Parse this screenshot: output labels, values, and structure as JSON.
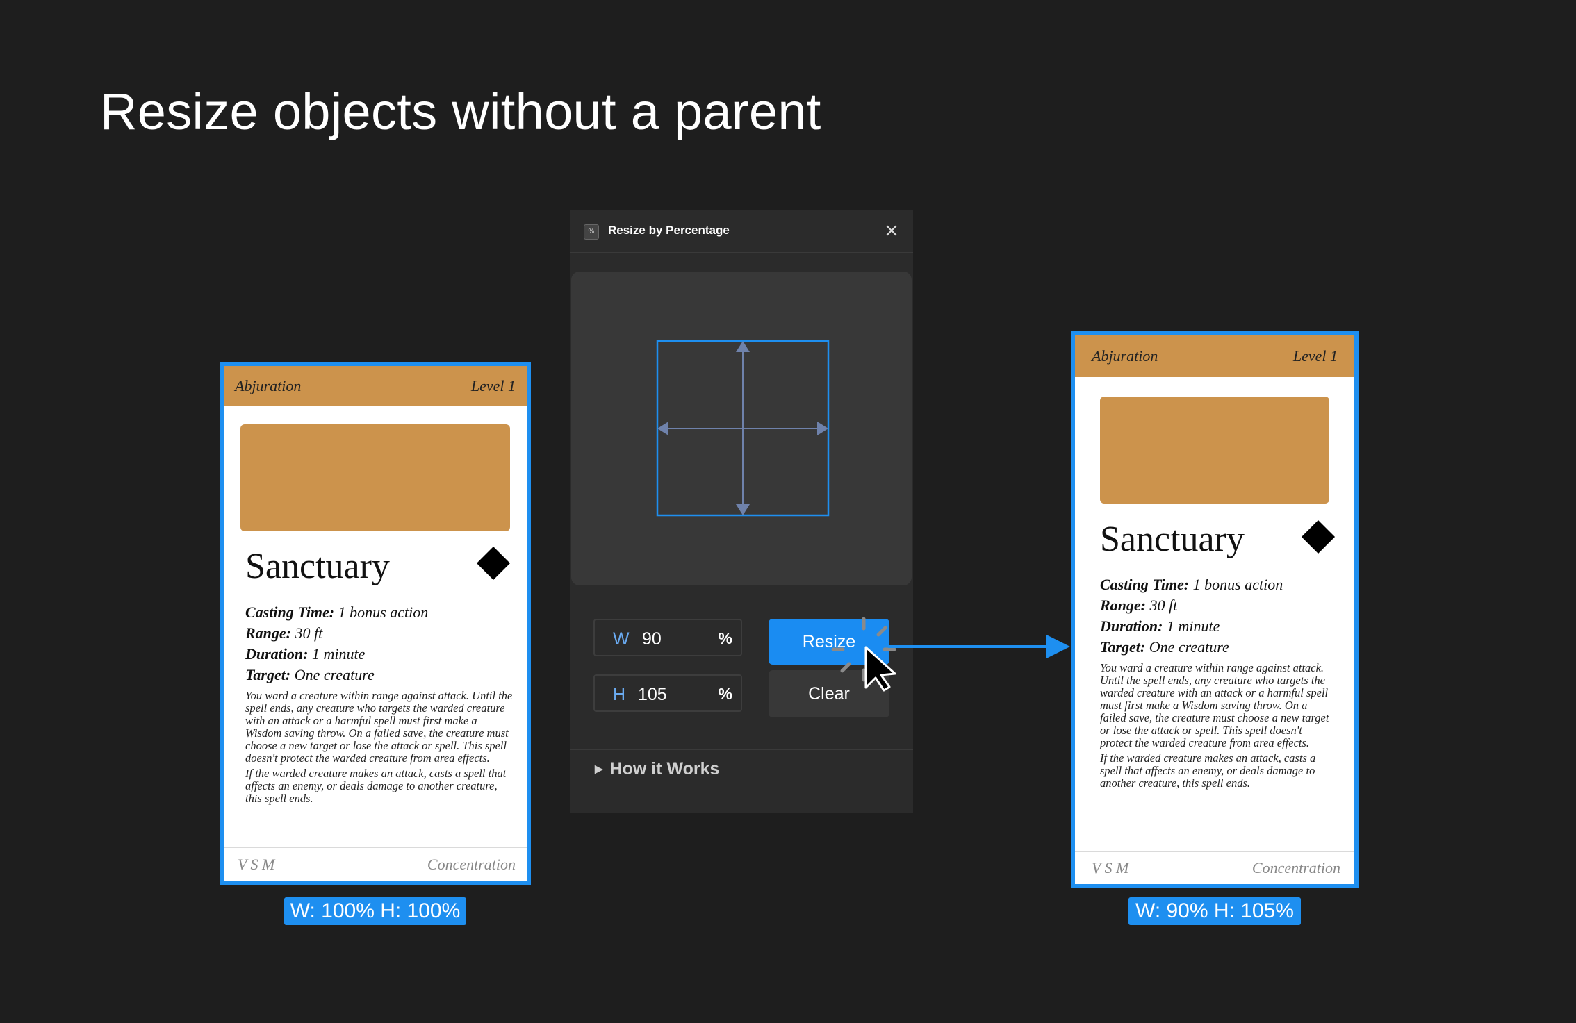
{
  "heading": "Resize objects without a parent",
  "card": {
    "school": "Abjuration",
    "level": "Level 1",
    "name": "Sanctuary",
    "stats": [
      {
        "label": "Casting Time:",
        "value": "1 bonus action"
      },
      {
        "label": "Range:",
        "value": "30 ft"
      },
      {
        "label": "Duration:",
        "value": "1 minute"
      },
      {
        "label": "Target:",
        "value": "One creature"
      }
    ],
    "description": [
      "You ward a creature within range against attack. Until the spell ends, any creature who targets the warded creature with an attack or a harmful spell must first make a Wisdom saving throw. On a failed save, the creature must choose a new target or lose the attack or spell. This spell doesn't protect the warded creature from area effects.",
      "If the warded creature makes an attack, casts a spell that affects an enemy, or deals damage to another creature, this spell ends."
    ],
    "components": "V  S  M",
    "concentration": "Concentration"
  },
  "before_badge": "W: 100% H: 100%",
  "after_badge": "W: 90% H: 105%",
  "plugin": {
    "title": "Resize by Percentage",
    "icon": "plugin-icon",
    "width_label": "W",
    "width_value": "90",
    "height_label": "H",
    "height_value": "105",
    "unit": "%",
    "resize_label": "Resize",
    "clear_label": "Clear",
    "how_label": "How it Works"
  },
  "colors": {
    "background": "#1e1e1e",
    "accent": "#1e8ff0",
    "card_tan": "#cc934c",
    "panel": "#2b2b2b"
  }
}
